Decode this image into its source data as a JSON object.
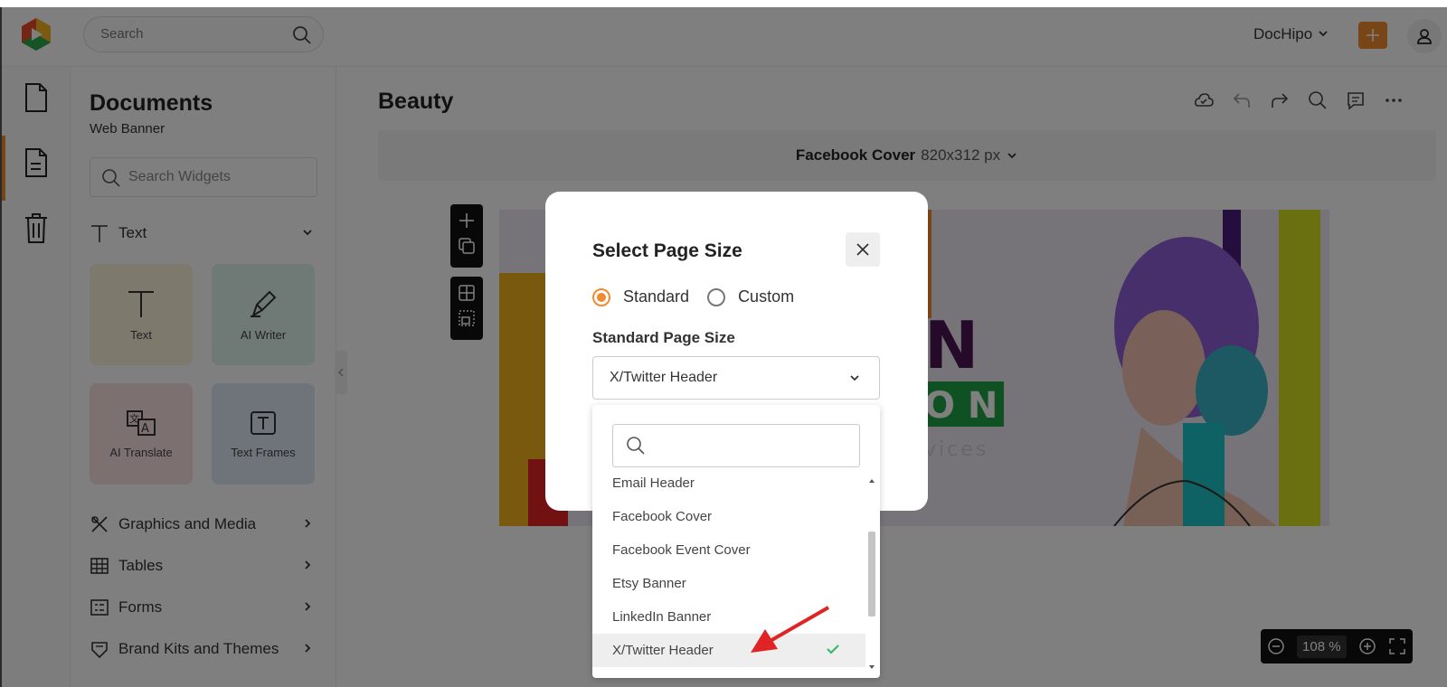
{
  "topbar": {
    "search_placeholder": "Search",
    "workspace": "DocHipo",
    "plus": "+"
  },
  "panel": {
    "title": "Documents",
    "subtitle": "Web Banner",
    "search_placeholder": "Search Widgets",
    "text_section": "Text",
    "tiles": [
      {
        "label": "Text"
      },
      {
        "label": "AI Writer"
      },
      {
        "label": "AI Translate"
      },
      {
        "label": "Text Frames"
      }
    ],
    "sections": [
      {
        "label": "Graphics and Media"
      },
      {
        "label": "Tables"
      },
      {
        "label": "Forms"
      },
      {
        "label": "Brand Kits and Themes"
      }
    ]
  },
  "main": {
    "doc_title": "Beauty",
    "size_name": "Facebook Cover",
    "size_dims": "820x312 px",
    "zoom": "108 %",
    "banner_text": {
      "line1": "N",
      "line2": "O N",
      "line3": "vices"
    }
  },
  "modal": {
    "title": "Select Page Size",
    "radio_standard": "Standard",
    "radio_custom": "Custom",
    "standard_label": "Standard Page Size",
    "selected_value": "X/Twitter Header"
  },
  "dropdown": {
    "search_value": "",
    "items": [
      {
        "label": "Email Header",
        "selected": false
      },
      {
        "label": "Facebook Cover",
        "selected": false
      },
      {
        "label": "Facebook Event Cover",
        "selected": false
      },
      {
        "label": "Etsy Banner",
        "selected": false
      },
      {
        "label": "LinkedIn Banner",
        "selected": false
      },
      {
        "label": "X/Twitter Header",
        "selected": true
      }
    ]
  },
  "colors": {
    "accent": "#f08a2c",
    "check": "#3cb371",
    "arrow": "#e02424"
  }
}
